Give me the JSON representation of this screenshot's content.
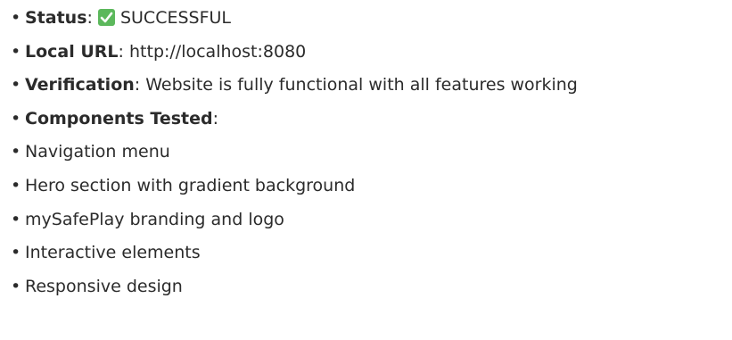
{
  "items": [
    {
      "label": "Status",
      "sep": ": ",
      "value": "SUCCESSFUL",
      "icon": "check-mark-button-icon"
    },
    {
      "label": "Local URL",
      "sep": ": ",
      "value": "http://localhost:8080"
    },
    {
      "label": "Verification",
      "sep": ": ",
      "value": "Website is fully functional with all features working"
    },
    {
      "label": "Components Tested",
      "sep": ":",
      "value": ""
    },
    {
      "value": "Navigation menu"
    },
    {
      "value": "Hero section with gradient background"
    },
    {
      "value": "mySafePlay branding and logo"
    },
    {
      "value": "Interactive elements"
    },
    {
      "value": "Responsive design"
    }
  ],
  "colors": {
    "text": "#2b2b2b",
    "check_icon": "#5cb85c"
  }
}
